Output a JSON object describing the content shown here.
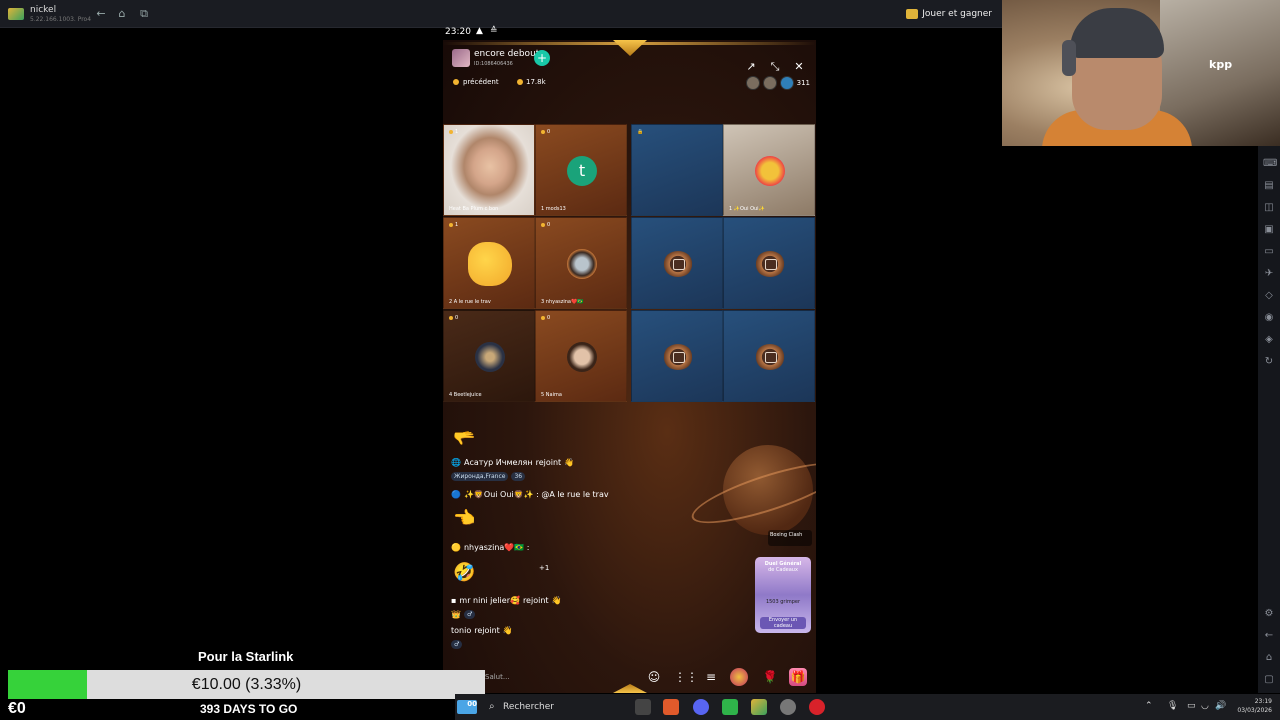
{
  "emulator": {
    "app_name": "nickel",
    "app_sub": "5.22.166.1003. Pro4",
    "play_label": "Jouer et gagner"
  },
  "webcam": {
    "cap_text": "kpp"
  },
  "phone_status": {
    "time": "23:20",
    "warn": "▲",
    "notif": "≙"
  },
  "room": {
    "title": "encore debout",
    "id": "ID:1086406436",
    "follow": "+",
    "prev_label": "précédent",
    "coins": "17.8k",
    "viewers": "311"
  },
  "seats": [
    {
      "badge": "1",
      "label": "Heat   Ba Plum c bon",
      "kind": "girl"
    },
    {
      "badge": "0",
      "label": "1   mods13",
      "kind": "letter",
      "letter": "t"
    },
    {
      "badge": "",
      "label": "",
      "kind": "empty"
    },
    {
      "badge": "",
      "label": "1   ✨Oui Oui✨",
      "kind": "cartoon"
    },
    {
      "badge": "1",
      "label": "2   A le rue le trav",
      "kind": "hand"
    },
    {
      "badge": "0",
      "label": "3   nhyaszina❤️🇧🇷",
      "kind": "avatar"
    },
    {
      "badge": "",
      "label": "",
      "kind": "chair"
    },
    {
      "badge": "",
      "label": "",
      "kind": "chair"
    },
    {
      "badge": "0",
      "label": "4   Beetlejuice",
      "kind": "avatar2"
    },
    {
      "badge": "0",
      "label": "5   Naima",
      "kind": "avatar3"
    },
    {
      "badge": "",
      "label": "",
      "kind": "chair"
    },
    {
      "badge": "",
      "label": "",
      "kind": "chair"
    }
  ],
  "chat": {
    "line1_user": "Асатур Ичмелян",
    "line1_action": "rejoint",
    "line1_loc": "Жиронда,France",
    "line1_age": "36",
    "line2": "✨🦁Oui Oui🦁✨ : @A le rue le trav",
    "line3": "nhyaszina❤️🇧🇷 :",
    "plus": "+1",
    "line4_user": "mr nini jelier🥰",
    "line4_action": "rejoint",
    "line5_user": "tonio",
    "line5_action": "rejoint",
    "say": "Salut..."
  },
  "promo": {
    "boxing": "Boxing Clash",
    "card_title": "Duel Général",
    "card_sub": "de Cadeaux",
    "card_count": "1503 grimper",
    "card_btn": "Envoyer un cadeau"
  },
  "goal": {
    "title": "Pour la Starlink",
    "amount": "€10.00 (3.33%)",
    "current": "€0",
    "days": "393 DAYS TO GO",
    "progress_fraction": 0.0333
  },
  "taskbar": {
    "search": "Rechercher",
    "weather": "00",
    "time": "23:19",
    "date": "03/03/2026"
  }
}
